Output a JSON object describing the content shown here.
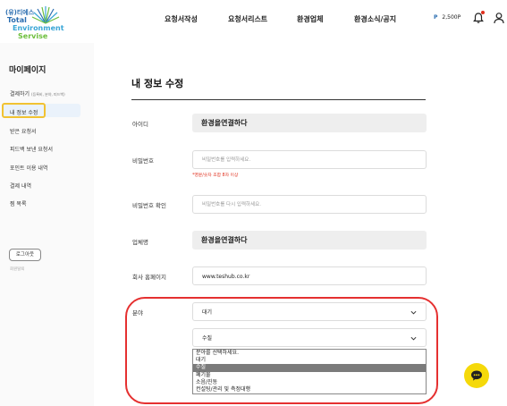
{
  "logo": {
    "badge": "(유)티에스",
    "line1": "Total",
    "line2": "Environment",
    "line3": "Servise"
  },
  "nav": [
    "요청서작성",
    "요청서리스트",
    "환경업체",
    "환경소식/공지"
  ],
  "header": {
    "point_symbol": "P",
    "point_value": "2,500P"
  },
  "sidebar": {
    "title": "마이페이지",
    "items": [
      {
        "label": "결제하기",
        "note": "(등록비, 분야, 피드백)"
      },
      {
        "label": "내 정보 수정"
      },
      {
        "label": "받은 요청서"
      },
      {
        "label": "피드백 보낸 요청서"
      },
      {
        "label": "포인트 이용 내역"
      },
      {
        "label": "결제 내역"
      },
      {
        "label": "찜 목록"
      }
    ],
    "logout": "로그아웃",
    "withdraw": "회원탈퇴"
  },
  "form": {
    "title": "내 정보 수정",
    "id_label": "아이디",
    "id_value": "환경을연결하다",
    "pw_label": "비밀번호",
    "pw_placeholder": "비밀번호를 입력하세요.",
    "pw_hint": "*영문/숫자 조합 8자 이상",
    "pw_confirm_label": "비밀번호 확인",
    "pw_confirm_placeholder": "비밀번호를 다시 입력하세요.",
    "company_label": "업체명",
    "company_value": "환경을연결하다",
    "homepage_label": "회사 홈페이지",
    "homepage_value": "www.teshub.co.kr",
    "field_label": "분야",
    "field_select_1": "대기",
    "field_select_2": "수질",
    "field_options": [
      "분야를 선택하세요.",
      "대기",
      "수질",
      "폐기물",
      "소음/진동",
      "컨설팅/관리 및 측정대행"
    ],
    "field_options_selected": "수질"
  },
  "colors": {
    "accent_blue": "#2a6db0",
    "highlight_red": "#e53030",
    "sidebar_outline": "#f1c232",
    "hint_red": "#e0301e",
    "chat_yellow": "#f5d90a"
  },
  "icons": [
    "bell-icon",
    "user-icon",
    "chevron-down-icon",
    "chat-icon"
  ]
}
